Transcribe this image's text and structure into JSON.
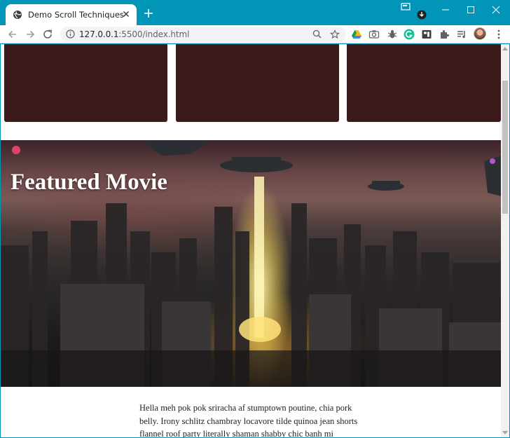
{
  "browser": {
    "tab_title": "Demo Scroll Techniques",
    "url_host": "127.0.0.1",
    "url_rest": ":5500/index.html",
    "accent": "#0195b7"
  },
  "page": {
    "hero_title": "Featured Movie",
    "article_text": "Hella meh pok pok sriracha af stumptown poutine, chia pork belly. Irony schlitz chambray locavore tilde quinoa jean shorts flannel roof party literally shaman shabby chic banh mi helvetica. Meggings",
    "card_color": "#3c191a"
  },
  "icons": {
    "favicon": "globe-icon",
    "close": "close-icon",
    "newtab": "plus-icon",
    "back": "arrow-left-icon",
    "forward": "arrow-right-icon",
    "reload": "reload-icon",
    "info": "info-icon",
    "zoom": "magnifier-icon",
    "star": "star-icon"
  }
}
